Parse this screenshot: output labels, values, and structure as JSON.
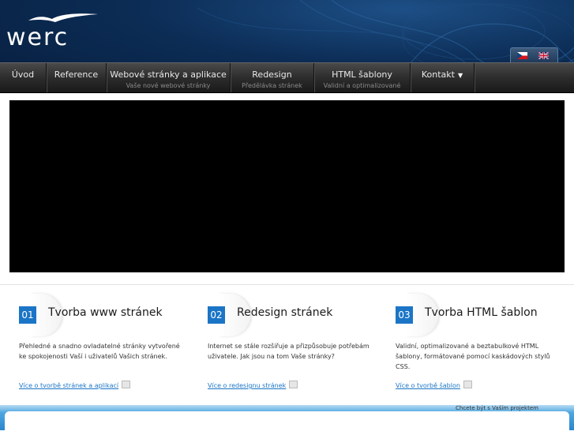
{
  "header": {
    "logo_text": "werc",
    "languages": [
      {
        "code": "cs",
        "icon": "czech-flag-icon"
      },
      {
        "code": "en",
        "icon": "uk-flag-icon"
      }
    ]
  },
  "nav": {
    "items": [
      {
        "label": "Úvod",
        "sub": ""
      },
      {
        "label": "Reference",
        "sub": ""
      },
      {
        "label": "Webové stránky a aplikace",
        "sub": "Vaše nové webové stránky"
      },
      {
        "label": "Redesign",
        "sub": "Předělávka stránek"
      },
      {
        "label": "HTML šablony",
        "sub": "Validní a optimalizované"
      },
      {
        "label": "Kontakt",
        "sub": ""
      }
    ]
  },
  "features": [
    {
      "number": "01",
      "title": "Tvorba www stránek",
      "text": "Přehledné a snadno ovladatelné stránky vytvořené ke spokojenosti Vaší i uživatelů Vašich stránek.",
      "link": "Více o tvorbě stránek a aplikací"
    },
    {
      "number": "02",
      "title": "Redesign stránek",
      "text": "Internet se stále rozšiřuje a přizpůsobuje potřebám uživatele. Jak jsou na tom Vaše stránky?",
      "link": "Více o redesignu stránek"
    },
    {
      "number": "03",
      "title": "Tvorba HTML šablon",
      "text": "Validní, optimalizované a beztabulkové HTML šablony, formátované pomocí kaskádových stylů CSS.",
      "link": "Více o tvorbě šablon"
    }
  ],
  "footer": {
    "left_text": "",
    "right_text": "Chcete být s Vaším projektem"
  },
  "colors": {
    "accent": "#1b75c6",
    "header_dark": "#071d3c",
    "nav_dark": "#2c2c2c"
  }
}
